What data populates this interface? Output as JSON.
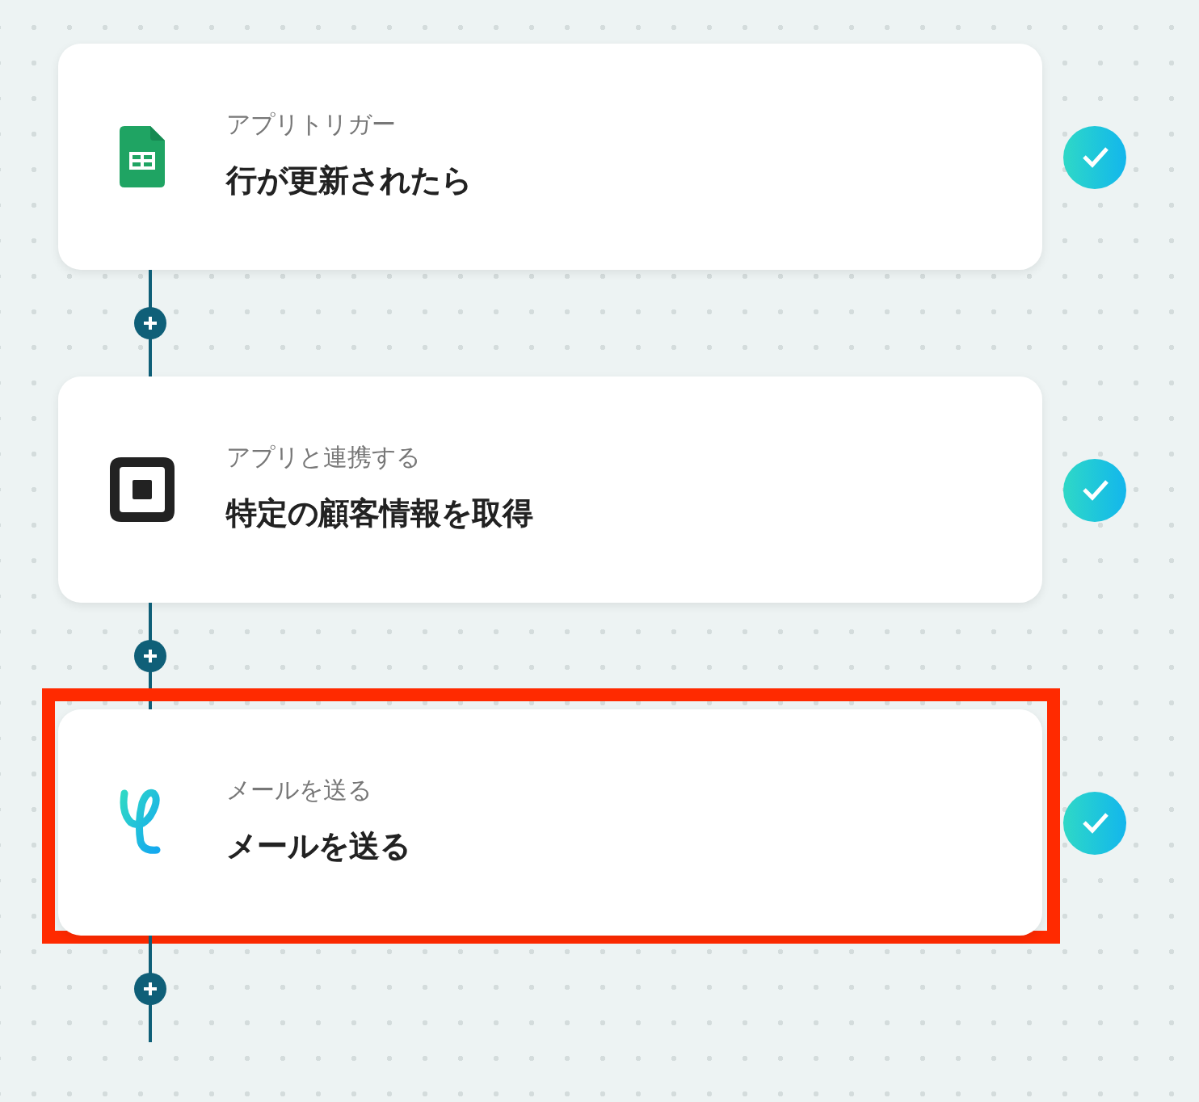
{
  "steps": [
    {
      "kind": "sheets",
      "label": "アプリトリガー",
      "title": "行が更新されたら",
      "completed": true,
      "highlighted": false
    },
    {
      "kind": "square",
      "label": "アプリと連携する",
      "title": "特定の顧客情報を取得",
      "completed": true,
      "highlighted": false
    },
    {
      "kind": "mail",
      "label": "メールを送る",
      "title": "メールを送る",
      "completed": true,
      "highlighted": true
    }
  ]
}
